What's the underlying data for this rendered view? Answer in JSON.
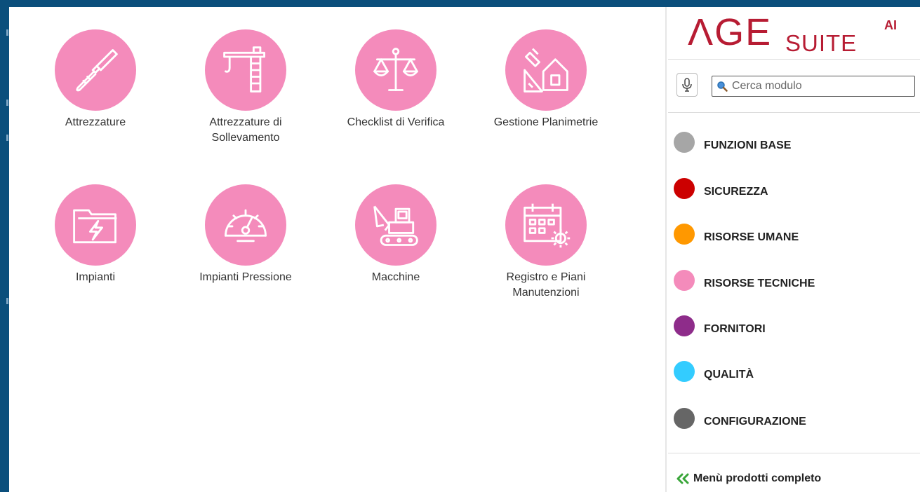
{
  "tiles": [
    {
      "label": "Attrezzature",
      "icon": "screwdriver-icon"
    },
    {
      "label": "Attrezzature di\nSollevamento",
      "icon": "crane-icon"
    },
    {
      "label": "Checklist di Verifica",
      "icon": "balance-scale-icon"
    },
    {
      "label": "Gestione Planimetrie",
      "icon": "floor-plan-house-icon"
    },
    {
      "label": "Impianti",
      "icon": "electrical-folder-icon"
    },
    {
      "label": "Impianti Pressione",
      "icon": "pressure-gauge-icon"
    },
    {
      "label": "Macchine",
      "icon": "excavator-icon"
    },
    {
      "label": "Registro e Piani\nManutenzioni",
      "icon": "calendar-gear-icon"
    }
  ],
  "sidebar": {
    "logo": {
      "main": "ΛGE",
      "suite": "SUITE",
      "ai": "AI"
    },
    "search": {
      "placeholder": "Cerca modulo"
    },
    "categories": [
      {
        "label": "FUNZIONI BASE",
        "color": "#a6a6a6"
      },
      {
        "label": "SICUREZZA",
        "color": "#cc0000"
      },
      {
        "label": "RISORSE UMANE",
        "color": "#ff9800"
      },
      {
        "label": "RISORSE TECNICHE",
        "color": "#f48bbb"
      },
      {
        "label": "FORNITORI",
        "color": "#8e2c8a"
      },
      {
        "label": "QUALITÀ",
        "color": "#33ccff"
      },
      {
        "label": "CONFIGURAZIONE",
        "color": "#666666"
      }
    ],
    "full_menu_label": "Menù prodotti completo"
  },
  "colors": {
    "tile_bg": "#f48bbb",
    "frame": "#0b4f7c",
    "brand": "#b71c33",
    "chevron": "#3aa63a"
  }
}
